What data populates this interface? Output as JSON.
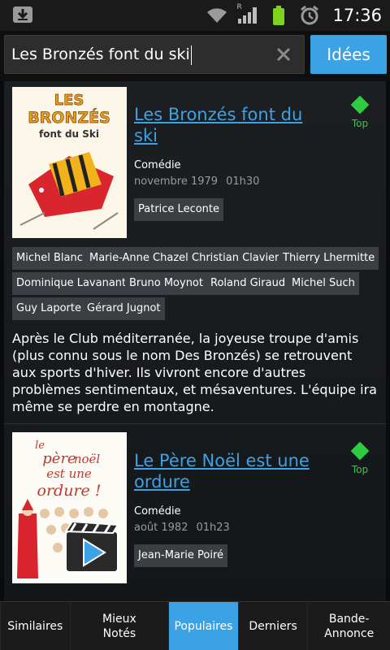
{
  "status_bar": {
    "time": "17:36",
    "icons": [
      "download-icon",
      "wifi-icon",
      "signal-icon",
      "battery-icon",
      "alarm-icon"
    ],
    "signal_badge": "R"
  },
  "search": {
    "value": "Les Bronzés font du ski",
    "ideas_label": "Idées"
  },
  "movies": [
    {
      "title": "Les Bronzés font du ski",
      "genre": "Comédie",
      "date": "novembre 1979",
      "duration": "01h30",
      "director": "Patrice Leconte",
      "top_label": "Top",
      "poster_text": [
        "LES",
        "BRONZÉS",
        "font du Ski"
      ],
      "cast": [
        "Michel Blanc",
        "Marie-Anne Chazel",
        "Christian Clavier",
        "Thierry Lhermitte",
        "Dominique Lavanant",
        "Bruno Moynot",
        "Roland Giraud",
        "Michel Such",
        "Guy Laporte",
        "Gérard Jugnot"
      ],
      "synopsis": "Après le Club méditerranée, la joyeuse troupe d'amis (plus connu sous le nom Des Bronzés) se retrouvent aux sports d'hiver. Ils vivront encore d'autres problèmes sentimentaux, et mésaventures. L'équipe ira même se perdre en montagne."
    },
    {
      "title": "Le Père Noël est une ordure",
      "genre": "Comédie",
      "date": "août 1982",
      "duration": "01h23",
      "director": "Jean-Marie Poiré",
      "top_label": "Top",
      "poster_text": [
        "le",
        "père",
        "noël",
        "est une",
        "ordure !"
      ]
    }
  ],
  "tabs": [
    {
      "label": "Similaires",
      "active": false
    },
    {
      "label": "Mieux Notés",
      "active": false
    },
    {
      "label": "Populaires",
      "active": true
    },
    {
      "label": "Derniers",
      "active": false
    },
    {
      "label": "Bande-Annonce",
      "active": false
    }
  ],
  "colors": {
    "accent": "#3ba3e5",
    "top_green": "#2ecc40",
    "chip_bg": "#3b3f43"
  }
}
